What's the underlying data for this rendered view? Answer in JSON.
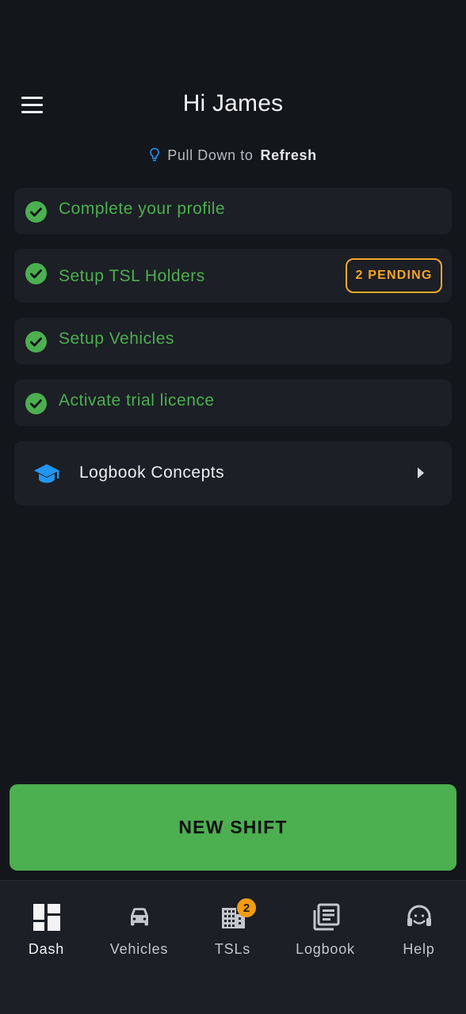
{
  "header": {
    "title": "Hi James",
    "menu_icon": "hamburger-menu-icon"
  },
  "hint": {
    "prefix": "Pull Down to",
    "action": "Refresh",
    "icon": "lightbulb-icon"
  },
  "colors": {
    "background": "#13161b",
    "card": "#1c1f25",
    "success": "#4caf50",
    "warning": "#f5a524",
    "accent_blue": "#2196f3"
  },
  "tasks": [
    {
      "label": "Complete your profile",
      "icon": "check-circle-icon",
      "done": true
    },
    {
      "label": "Setup TSL Holders",
      "icon": "check-circle-icon",
      "done": true,
      "badge": "2 PENDING"
    },
    {
      "label": "Setup Vehicles",
      "icon": "check-circle-icon",
      "done": true
    },
    {
      "label": "Activate trial licence",
      "icon": "check-circle-icon",
      "done": true
    }
  ],
  "concepts": {
    "label": "Logbook Concepts",
    "icon": "graduation-cap-icon",
    "chevron": "chevron-right-icon"
  },
  "new_shift": {
    "label": "NEW SHIFT"
  },
  "nav": {
    "items": [
      {
        "label": "Dash",
        "icon": "dashboard-icon",
        "active": true
      },
      {
        "label": "Vehicles",
        "icon": "car-icon"
      },
      {
        "label": "TSLs",
        "icon": "building-icon",
        "badge": "2"
      },
      {
        "label": "Logbook",
        "icon": "logbook-icon"
      },
      {
        "label": "Help",
        "icon": "headset-icon"
      }
    ]
  }
}
